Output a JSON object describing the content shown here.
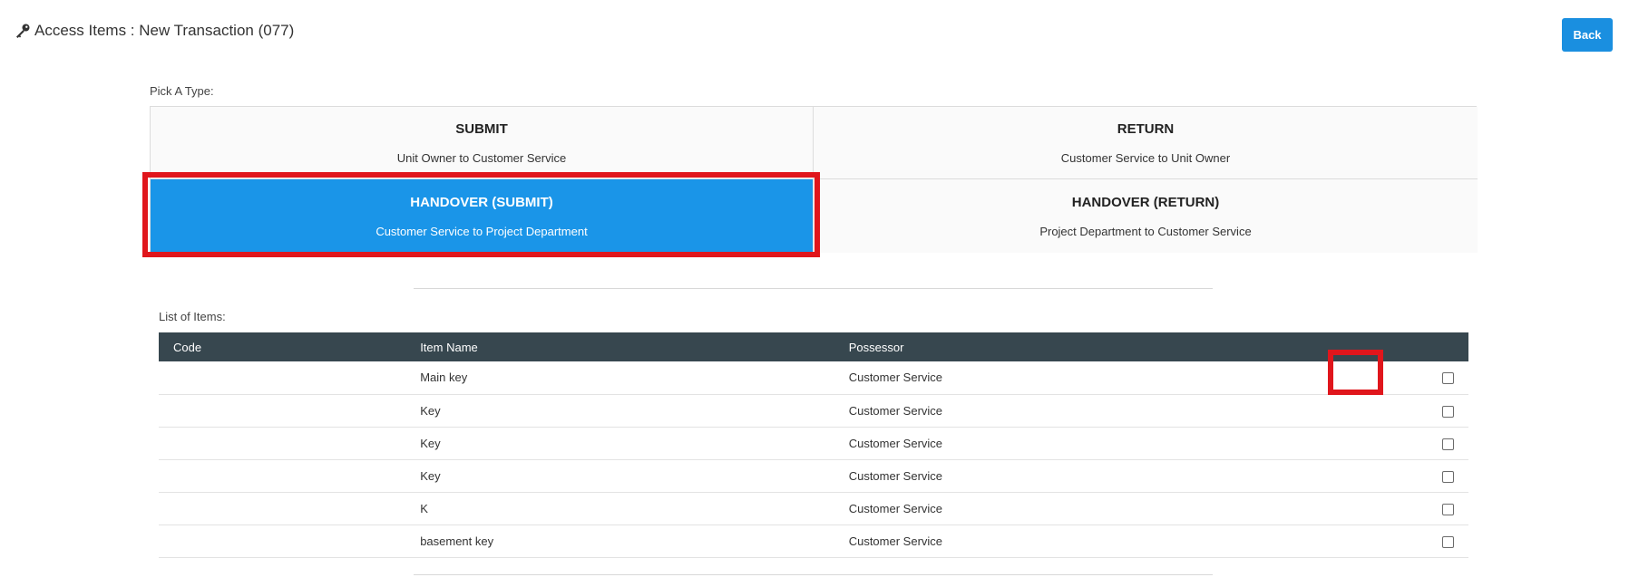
{
  "header": {
    "title": "Access Items : New Transaction (077)",
    "back_label": "Back",
    "key_icon": "key-icon"
  },
  "colors": {
    "accent": "#1a95e8",
    "table_header": "#37474f",
    "highlight": "#e0161c"
  },
  "type_picker": {
    "label": "Pick A Type:",
    "options": [
      {
        "title": "SUBMIT",
        "subtitle": "Unit Owner to Customer Service",
        "selected": false
      },
      {
        "title": "RETURN",
        "subtitle": "Customer Service to Unit Owner",
        "selected": false
      },
      {
        "title": "HANDOVER (SUBMIT)",
        "subtitle": "Customer Service to Project Department",
        "selected": true
      },
      {
        "title": "HANDOVER (RETURN)",
        "subtitle": "Project Department to Customer Service",
        "selected": false
      }
    ]
  },
  "items": {
    "label": "List of Items:",
    "columns": [
      "Code",
      "Item Name",
      "Possessor",
      ""
    ],
    "rows": [
      {
        "code": "",
        "name": "Main key",
        "possessor": "Customer Service",
        "checked": false
      },
      {
        "code": "",
        "name": "Key",
        "possessor": "Customer Service",
        "checked": false
      },
      {
        "code": "",
        "name": "Key",
        "possessor": "Customer Service",
        "checked": false
      },
      {
        "code": "",
        "name": "Key",
        "possessor": "Customer Service",
        "checked": false
      },
      {
        "code": "",
        "name": "K",
        "possessor": "Customer Service",
        "checked": false
      },
      {
        "code": "",
        "name": "basement key",
        "possessor": "Customer Service",
        "checked": false
      }
    ]
  }
}
